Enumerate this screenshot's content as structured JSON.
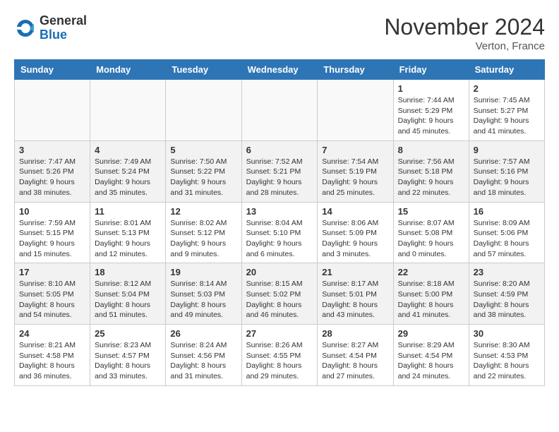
{
  "header": {
    "logo_line1": "General",
    "logo_line2": "Blue",
    "month": "November 2024",
    "location": "Verton, France"
  },
  "days_of_week": [
    "Sunday",
    "Monday",
    "Tuesday",
    "Wednesday",
    "Thursday",
    "Friday",
    "Saturday"
  ],
  "weeks": [
    [
      {
        "day": "",
        "info": ""
      },
      {
        "day": "",
        "info": ""
      },
      {
        "day": "",
        "info": ""
      },
      {
        "day": "",
        "info": ""
      },
      {
        "day": "",
        "info": ""
      },
      {
        "day": "1",
        "info": "Sunrise: 7:44 AM\nSunset: 5:29 PM\nDaylight: 9 hours and 45 minutes."
      },
      {
        "day": "2",
        "info": "Sunrise: 7:45 AM\nSunset: 5:27 PM\nDaylight: 9 hours and 41 minutes."
      }
    ],
    [
      {
        "day": "3",
        "info": "Sunrise: 7:47 AM\nSunset: 5:26 PM\nDaylight: 9 hours and 38 minutes."
      },
      {
        "day": "4",
        "info": "Sunrise: 7:49 AM\nSunset: 5:24 PM\nDaylight: 9 hours and 35 minutes."
      },
      {
        "day": "5",
        "info": "Sunrise: 7:50 AM\nSunset: 5:22 PM\nDaylight: 9 hours and 31 minutes."
      },
      {
        "day": "6",
        "info": "Sunrise: 7:52 AM\nSunset: 5:21 PM\nDaylight: 9 hours and 28 minutes."
      },
      {
        "day": "7",
        "info": "Sunrise: 7:54 AM\nSunset: 5:19 PM\nDaylight: 9 hours and 25 minutes."
      },
      {
        "day": "8",
        "info": "Sunrise: 7:56 AM\nSunset: 5:18 PM\nDaylight: 9 hours and 22 minutes."
      },
      {
        "day": "9",
        "info": "Sunrise: 7:57 AM\nSunset: 5:16 PM\nDaylight: 9 hours and 18 minutes."
      }
    ],
    [
      {
        "day": "10",
        "info": "Sunrise: 7:59 AM\nSunset: 5:15 PM\nDaylight: 9 hours and 15 minutes."
      },
      {
        "day": "11",
        "info": "Sunrise: 8:01 AM\nSunset: 5:13 PM\nDaylight: 9 hours and 12 minutes."
      },
      {
        "day": "12",
        "info": "Sunrise: 8:02 AM\nSunset: 5:12 PM\nDaylight: 9 hours and 9 minutes."
      },
      {
        "day": "13",
        "info": "Sunrise: 8:04 AM\nSunset: 5:10 PM\nDaylight: 9 hours and 6 minutes."
      },
      {
        "day": "14",
        "info": "Sunrise: 8:06 AM\nSunset: 5:09 PM\nDaylight: 9 hours and 3 minutes."
      },
      {
        "day": "15",
        "info": "Sunrise: 8:07 AM\nSunset: 5:08 PM\nDaylight: 9 hours and 0 minutes."
      },
      {
        "day": "16",
        "info": "Sunrise: 8:09 AM\nSunset: 5:06 PM\nDaylight: 8 hours and 57 minutes."
      }
    ],
    [
      {
        "day": "17",
        "info": "Sunrise: 8:10 AM\nSunset: 5:05 PM\nDaylight: 8 hours and 54 minutes."
      },
      {
        "day": "18",
        "info": "Sunrise: 8:12 AM\nSunset: 5:04 PM\nDaylight: 8 hours and 51 minutes."
      },
      {
        "day": "19",
        "info": "Sunrise: 8:14 AM\nSunset: 5:03 PM\nDaylight: 8 hours and 49 minutes."
      },
      {
        "day": "20",
        "info": "Sunrise: 8:15 AM\nSunset: 5:02 PM\nDaylight: 8 hours and 46 minutes."
      },
      {
        "day": "21",
        "info": "Sunrise: 8:17 AM\nSunset: 5:01 PM\nDaylight: 8 hours and 43 minutes."
      },
      {
        "day": "22",
        "info": "Sunrise: 8:18 AM\nSunset: 5:00 PM\nDaylight: 8 hours and 41 minutes."
      },
      {
        "day": "23",
        "info": "Sunrise: 8:20 AM\nSunset: 4:59 PM\nDaylight: 8 hours and 38 minutes."
      }
    ],
    [
      {
        "day": "24",
        "info": "Sunrise: 8:21 AM\nSunset: 4:58 PM\nDaylight: 8 hours and 36 minutes."
      },
      {
        "day": "25",
        "info": "Sunrise: 8:23 AM\nSunset: 4:57 PM\nDaylight: 8 hours and 33 minutes."
      },
      {
        "day": "26",
        "info": "Sunrise: 8:24 AM\nSunset: 4:56 PM\nDaylight: 8 hours and 31 minutes."
      },
      {
        "day": "27",
        "info": "Sunrise: 8:26 AM\nSunset: 4:55 PM\nDaylight: 8 hours and 29 minutes."
      },
      {
        "day": "28",
        "info": "Sunrise: 8:27 AM\nSunset: 4:54 PM\nDaylight: 8 hours and 27 minutes."
      },
      {
        "day": "29",
        "info": "Sunrise: 8:29 AM\nSunset: 4:54 PM\nDaylight: 8 hours and 24 minutes."
      },
      {
        "day": "30",
        "info": "Sunrise: 8:30 AM\nSunset: 4:53 PM\nDaylight: 8 hours and 22 minutes."
      }
    ]
  ]
}
